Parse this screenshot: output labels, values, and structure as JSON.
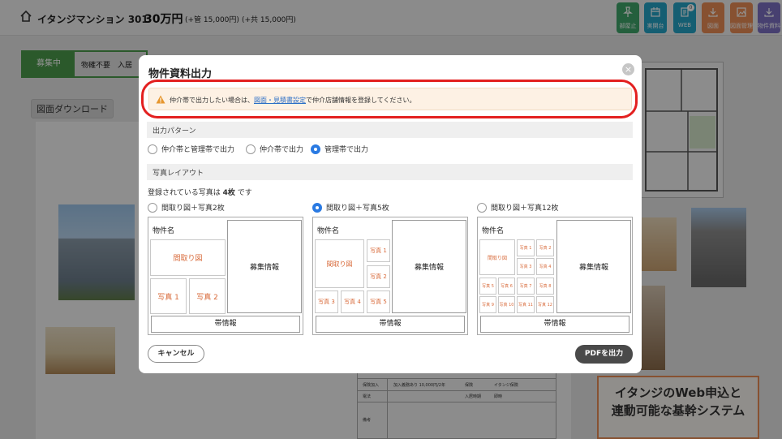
{
  "header": {
    "title": "イタンジマンション 301",
    "price": "30万円",
    "fee_management": "(+管 15,000円)",
    "fee_common": "(+共 15,000円)"
  },
  "toolbar": [
    {
      "label": "部屋止",
      "icon": "pin-icon",
      "color": "#3fa46a"
    },
    {
      "label": "実開台",
      "icon": "calendar-icon",
      "color": "#25a3c4"
    },
    {
      "label": "WEB",
      "icon": "document-icon",
      "color": "#25a3c4",
      "badge": "0"
    },
    {
      "label": "図面",
      "icon": "download-icon",
      "color": "#e88c55"
    },
    {
      "label": "図面管理",
      "icon": "image-icon",
      "color": "#e88c55"
    },
    {
      "label": "物件資料",
      "icon": "download-icon",
      "color": "#7a6fc2"
    }
  ],
  "status": {
    "tag": "募集中",
    "text": "物確不要　入居"
  },
  "download_label": "図面ダウンロード",
  "background": {
    "table_rows": [
      {
        "a": "保険加入",
        "b": "加入義務あり 10,000円/2年",
        "c": "保険",
        "d": "イタンジ保険"
      },
      {
        "a": "電法",
        "b": "",
        "c": "入居時期",
        "d": "即時"
      },
      {
        "a": "備考",
        "b": "",
        "c": "",
        "d": ""
      }
    ],
    "ad_text": "イタンジのWeb申込と\n連動可能な基幹システム"
  },
  "modal": {
    "title": "物件資料出力",
    "close": "×",
    "warning": {
      "prefix": "仲介帯で出力したい場合は、",
      "link": "図面・見積書設定",
      "suffix": "で仲介店舗情報を登録してください。"
    },
    "output_pattern": {
      "heading": "出力パターン",
      "options": [
        {
          "label": "仲介帯と管理帯で出力",
          "selected": false
        },
        {
          "label": "仲介帯で出力",
          "selected": false
        },
        {
          "label": "管理帯で出力",
          "selected": true
        }
      ]
    },
    "photo_layout": {
      "heading": "写真レイアウト",
      "count_prefix": "登録されている写真は ",
      "count": "4枚",
      "count_suffix": " です",
      "options": [
        {
          "label": "間取り図＋写真2枚",
          "selected": false
        },
        {
          "label": "間取り図＋写真5枚",
          "selected": true
        },
        {
          "label": "間取り図＋写真12枚",
          "selected": false
        }
      ],
      "preview": {
        "property_name": "物件名",
        "floorplan": "間取り図",
        "recruit_info": "募集情報",
        "band_info": "帯情報",
        "photos2": [
          "写真 1",
          "写真 2"
        ],
        "photos5": [
          "写真 1",
          "写真 2",
          "写真 3",
          "写真 4",
          "写真 5"
        ],
        "photos12": [
          "写真 1",
          "写真 2",
          "写真 3",
          "写真 4",
          "写真 5",
          "写真 6",
          "写真 7",
          "写真 8",
          "写真 9",
          "写真 10",
          "写真 11",
          "写真 12"
        ]
      }
    },
    "cancel_label": "キャンセル",
    "pdf_label": "PDFを出力"
  }
}
